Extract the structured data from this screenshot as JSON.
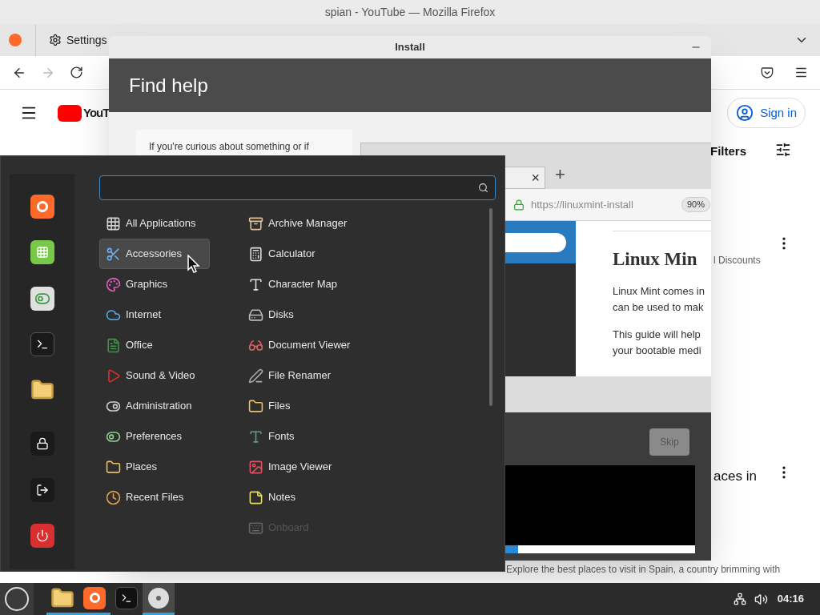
{
  "browser": {
    "title": "spian - YouTube — Mozilla Firefox",
    "tabs": [
      {
        "label": "Settings",
        "selected": false
      }
    ],
    "youtube": {
      "logo": "YouT",
      "sign_in": "Sign in",
      "filters": "Filters",
      "snippets": [
        "l Discounts",
        "aces in",
        "Explore the best places to visit in Spain, a country brimming with"
      ]
    }
  },
  "installer": {
    "title": "Install",
    "heading": "Find help",
    "intro": "If you're curious about something or if",
    "preview": {
      "tab_close": "×",
      "new_tab": "+",
      "url": "https://linuxmint-install",
      "zoom": "90%",
      "heading": "Linux Min",
      "paragraphs": [
        "Linux Mint comes in",
        "can be used to mak",
        "This guide will help",
        "your bootable medi"
      ]
    },
    "skip": {
      "label": "Skip",
      "disabled": true
    },
    "progress": {
      "level": 0.69
    }
  },
  "menu": {
    "favorites": [
      {
        "kind": "firefox"
      },
      {
        "kind": "software"
      },
      {
        "kind": "settings"
      },
      {
        "kind": "terminal"
      },
      {
        "kind": "files"
      },
      {
        "kind": "lock"
      },
      {
        "kind": "logout"
      },
      {
        "kind": "power"
      }
    ],
    "categories": [
      {
        "label": "All Applications",
        "selected": false
      },
      {
        "label": "Accessories",
        "selected": true
      },
      {
        "label": "Graphics",
        "selected": false
      },
      {
        "label": "Internet",
        "selected": false
      },
      {
        "label": "Office",
        "selected": false
      },
      {
        "label": "Sound & Video",
        "selected": false
      },
      {
        "label": "Administration",
        "selected": false
      },
      {
        "label": "Preferences",
        "selected": false
      },
      {
        "label": "Places",
        "selected": false
      },
      {
        "label": "Recent Files",
        "selected": false
      }
    ],
    "apps": [
      {
        "label": "Archive Manager",
        "disabled": false
      },
      {
        "label": "Calculator",
        "disabled": false
      },
      {
        "label": "Character Map",
        "disabled": false
      },
      {
        "label": "Disks",
        "disabled": false
      },
      {
        "label": "Document Viewer",
        "disabled": false
      },
      {
        "label": "File Renamer",
        "disabled": false
      },
      {
        "label": "Files",
        "disabled": false
      },
      {
        "label": "Fonts",
        "disabled": false
      },
      {
        "label": "Image Viewer",
        "disabled": false
      },
      {
        "label": "Notes",
        "disabled": false
      },
      {
        "label": "Onboard",
        "disabled": true
      }
    ]
  },
  "taskbar": {
    "apps": [
      {
        "kind": "files",
        "running": true,
        "focused": false
      },
      {
        "kind": "firefox",
        "running": true,
        "focused": false
      },
      {
        "kind": "terminal",
        "running": false,
        "focused": false
      },
      {
        "kind": "disc",
        "running": true,
        "focused": true
      }
    ],
    "clock": "04:16"
  }
}
